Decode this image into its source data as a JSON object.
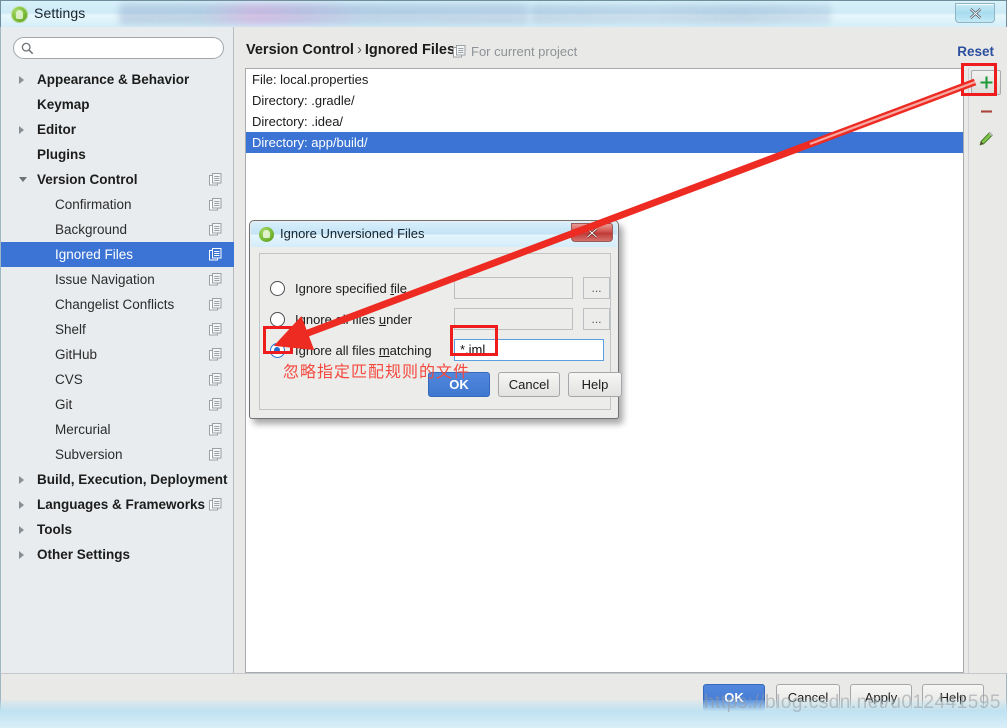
{
  "window": {
    "title": "Settings",
    "icon": "android-studio-icon",
    "close_label": "x"
  },
  "sidebar": {
    "search": {
      "placeholder": "",
      "value": "",
      "icon": "search-icon"
    },
    "items": [
      {
        "label": "Appearance & Behavior",
        "level": 0,
        "arrow": "right",
        "copy": false,
        "selected": false
      },
      {
        "label": "Keymap",
        "level": 0,
        "arrow": "none",
        "copy": false,
        "selected": false
      },
      {
        "label": "Editor",
        "level": 0,
        "arrow": "right",
        "copy": false,
        "selected": false
      },
      {
        "label": "Plugins",
        "level": 0,
        "arrow": "none",
        "copy": false,
        "selected": false
      },
      {
        "label": "Version Control",
        "level": 0,
        "arrow": "down",
        "copy": true,
        "selected": false
      },
      {
        "label": "Confirmation",
        "level": 1,
        "arrow": "none",
        "copy": true,
        "selected": false
      },
      {
        "label": "Background",
        "level": 1,
        "arrow": "none",
        "copy": true,
        "selected": false
      },
      {
        "label": "Ignored Files",
        "level": 1,
        "arrow": "none",
        "copy": true,
        "selected": true
      },
      {
        "label": "Issue Navigation",
        "level": 1,
        "arrow": "none",
        "copy": true,
        "selected": false
      },
      {
        "label": "Changelist Conflicts",
        "level": 1,
        "arrow": "none",
        "copy": true,
        "selected": false
      },
      {
        "label": "Shelf",
        "level": 1,
        "arrow": "none",
        "copy": true,
        "selected": false
      },
      {
        "label": "GitHub",
        "level": 1,
        "arrow": "none",
        "copy": true,
        "selected": false
      },
      {
        "label": "CVS",
        "level": 1,
        "arrow": "none",
        "copy": true,
        "selected": false
      },
      {
        "label": "Git",
        "level": 1,
        "arrow": "none",
        "copy": true,
        "selected": false
      },
      {
        "label": "Mercurial",
        "level": 1,
        "arrow": "none",
        "copy": true,
        "selected": false
      },
      {
        "label": "Subversion",
        "level": 1,
        "arrow": "none",
        "copy": true,
        "selected": false
      },
      {
        "label": "Build, Execution, Deployment",
        "level": 0,
        "arrow": "right",
        "copy": false,
        "selected": false
      },
      {
        "label": "Languages & Frameworks",
        "level": 0,
        "arrow": "right",
        "copy": true,
        "selected": false
      },
      {
        "label": "Tools",
        "level": 0,
        "arrow": "right",
        "copy": false,
        "selected": false
      },
      {
        "label": "Other Settings",
        "level": 0,
        "arrow": "right",
        "copy": false,
        "selected": false
      }
    ]
  },
  "main": {
    "breadcrumb_parent": "Version Control",
    "breadcrumb_sep": "›",
    "breadcrumb_current": "Ignored Files",
    "scope_note": "For current project",
    "scope_icon": "copy-icon",
    "reset_label": "Reset",
    "list_rows": [
      {
        "text": "File: local.properties",
        "selected": false
      },
      {
        "text": "Directory: .gradle/",
        "selected": false
      },
      {
        "text": "Directory: .idea/",
        "selected": false
      },
      {
        "text": "Directory: app/build/",
        "selected": true
      }
    ],
    "toolbar": [
      {
        "name": "add-button",
        "icon": "plus-icon",
        "highlighted": true
      },
      {
        "name": "remove-button",
        "icon": "minus-icon",
        "highlighted": false
      },
      {
        "name": "edit-button",
        "icon": "pencil-icon",
        "highlighted": false
      }
    ]
  },
  "footer": {
    "ok": "OK",
    "cancel": "Cancel",
    "apply": "Apply",
    "help": "Help"
  },
  "dialog": {
    "title": "Ignore Unversioned Files",
    "icon": "android-studio-icon",
    "close_label": "x",
    "options": [
      {
        "label_pre": "Ignore specified ",
        "label_mnemonic": "f",
        "label_post": "ile",
        "checked": false,
        "field_value": "",
        "field_active": false,
        "has_browse": true
      },
      {
        "label_pre": "Ignore all files ",
        "label_mnemonic": "u",
        "label_post": "nder",
        "checked": false,
        "field_value": "",
        "field_active": false,
        "has_browse": true
      },
      {
        "label_pre": "Ignore all files ",
        "label_mnemonic": "m",
        "label_post": "atching",
        "checked": true,
        "field_value": "*.iml",
        "field_active": true,
        "has_browse": false
      }
    ],
    "browse_label": "...",
    "ok": "OK",
    "cancel": "Cancel",
    "help": "Help"
  },
  "annotations": {
    "chinese_note": "忽略指定匹配规则的文件",
    "arrow_color": "#ee2b22",
    "box_color": "#ee1c1c",
    "watermark": "https://blog.csdn.net/u012441595"
  }
}
